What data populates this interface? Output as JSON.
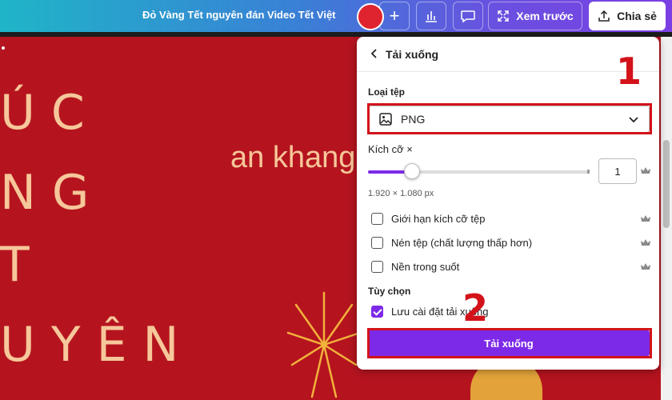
{
  "topbar": {
    "document_title": "Đỏ Vàng Tết nguyên đán Video Tết Việt",
    "avatar_text": "",
    "preview_label": "Xem trước",
    "share_label": "Chia sẻ"
  },
  "canvas": {
    "line1": "ÚC",
    "line2": "NG",
    "line3": "T",
    "line4": "UYÊN",
    "small_text": "an khang",
    "colors": {
      "background": "#b5141f",
      "text": "#f6c79a"
    }
  },
  "panel": {
    "title": "Tải xuống",
    "file_type_label": "Loại tệp",
    "file_type_value": "PNG",
    "size_label": "Kích cỡ ×",
    "size_value": "1",
    "size_slider_fraction": 0.2,
    "dimensions": "1.920 × 1.080 px",
    "options": [
      {
        "label": "Giới hạn kích cỡ tệp",
        "checked": false,
        "premium": true
      },
      {
        "label": "Nén tệp (chất lượng thấp hơn)",
        "checked": false,
        "premium": true
      },
      {
        "label": "Nền trong suốt",
        "checked": false,
        "premium": true
      }
    ],
    "extra_label": "Tùy chọn",
    "save_settings_label": "Lưu cài đặt tải xuống",
    "save_settings_checked": true,
    "download_label": "Tải xuống",
    "accent_color": "#7d2ae8"
  },
  "annotations": {
    "step1": "1",
    "step2": "2",
    "color": "#d3121a"
  }
}
